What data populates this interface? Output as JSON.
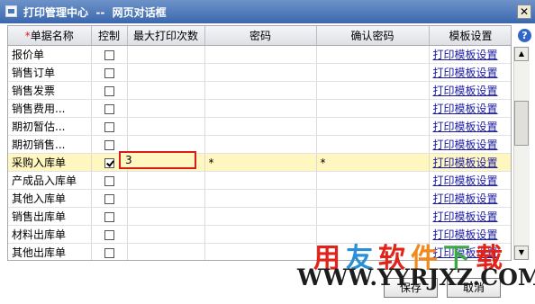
{
  "window": {
    "title": "打印管理中心  --  网页对话框",
    "close": "✕",
    "help": "?"
  },
  "grid": {
    "columns": {
      "required_mark": "*",
      "name": "单据名称",
      "control": "控制",
      "max_print": "最大打印次数",
      "password": "密码",
      "confirm": "确认密码",
      "template": "模板设置"
    },
    "rows": [
      {
        "name": "报价单",
        "checked": false,
        "max": "",
        "pwd": "",
        "confirm": "",
        "template": "打印模板设置"
      },
      {
        "name": "销售订单",
        "checked": false,
        "max": "",
        "pwd": "",
        "confirm": "",
        "template": "打印模板设置"
      },
      {
        "name": "销售发票",
        "checked": false,
        "max": "",
        "pwd": "",
        "confirm": "",
        "template": "打印模板设置"
      },
      {
        "name": "销售费用...",
        "checked": false,
        "max": "",
        "pwd": "",
        "confirm": "",
        "template": "打印模板设置"
      },
      {
        "name": "期初暂估...",
        "checked": false,
        "max": "",
        "pwd": "",
        "confirm": "",
        "template": "打印模板设置"
      },
      {
        "name": "期初销售...",
        "checked": false,
        "max": "",
        "pwd": "",
        "confirm": "",
        "template": "打印模板设置"
      },
      {
        "name": "采购入库单",
        "checked": true,
        "max": "",
        "pwd": "*",
        "confirm": "*",
        "template": "打印模板设置",
        "selected": true
      },
      {
        "name": "产成品入库单",
        "checked": false,
        "max": "",
        "pwd": "",
        "confirm": "",
        "template": "打印模板设置"
      },
      {
        "name": "其他入库单",
        "checked": false,
        "max": "",
        "pwd": "",
        "confirm": "",
        "template": "打印模板设置"
      },
      {
        "name": "销售出库单",
        "checked": false,
        "max": "",
        "pwd": "",
        "confirm": "",
        "template": "打印模板设置"
      },
      {
        "name": "材料出库单",
        "checked": false,
        "max": "",
        "pwd": "",
        "confirm": "",
        "template": "打印模板设置"
      },
      {
        "name": "其他出库单",
        "checked": false,
        "max": "",
        "pwd": "",
        "confirm": "",
        "template": "打印模板设置"
      }
    ],
    "editing_value": "3"
  },
  "buttons": {
    "save": "保存",
    "cancel": "取消"
  },
  "watermark": {
    "chars": [
      "用",
      "友",
      "软",
      "件",
      "下",
      "载"
    ],
    "colors": [
      "#e2231a",
      "#2b8fd6",
      "#e2231a",
      "#f08a1c",
      "#3aa845",
      "#e2231a"
    ],
    "url": "WWW.YYRJXZ.COM"
  },
  "colors": {
    "selected_row": "#fff7bf",
    "link": "#1a1aa6",
    "edit_border": "#d81c1c"
  }
}
